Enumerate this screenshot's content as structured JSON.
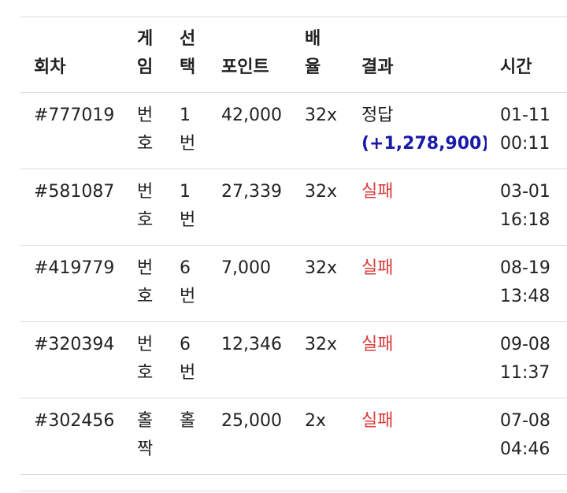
{
  "headers": {
    "round": "회차",
    "game": [
      "게",
      "임"
    ],
    "pick": [
      "선",
      "택"
    ],
    "point": "포인트",
    "rate": [
      "배",
      "율"
    ],
    "result": "결과",
    "time": "시간"
  },
  "rows": [
    {
      "round": "#777019",
      "game": [
        "번",
        "호"
      ],
      "pick": [
        "1",
        "번"
      ],
      "point": "42,000",
      "rate": "32x",
      "result": "정답",
      "win": "(+1,278,900)",
      "time": [
        "01-11",
        "00:11"
      ]
    },
    {
      "round": "#581087",
      "game": [
        "번",
        "호"
      ],
      "pick": [
        "1",
        "번"
      ],
      "point": "27,339",
      "rate": "32x",
      "result": "실패",
      "time": [
        "03-01",
        "16:18"
      ]
    },
    {
      "round": "#419779",
      "game": [
        "번",
        "호"
      ],
      "pick": [
        "6",
        "번"
      ],
      "point": "7,000",
      "rate": "32x",
      "result": "실패",
      "time": [
        "08-19",
        "13:48"
      ]
    },
    {
      "round": "#320394",
      "game": [
        "번",
        "호"
      ],
      "pick": [
        "6",
        "번"
      ],
      "point": "12,346",
      "rate": "32x",
      "result": "실패",
      "time": [
        "09-08",
        "11:37"
      ]
    },
    {
      "round": "#302456",
      "game": [
        "홀",
        "짝"
      ],
      "pick": [
        "홀"
      ],
      "point": "25,000",
      "rate": "2x",
      "result": "실패",
      "time": [
        "07-08",
        "04:46"
      ]
    }
  ],
  "colors": {
    "win_amount": "#1a1aa8",
    "fail": "#d93a3a",
    "divider": "#dcdcdc"
  }
}
